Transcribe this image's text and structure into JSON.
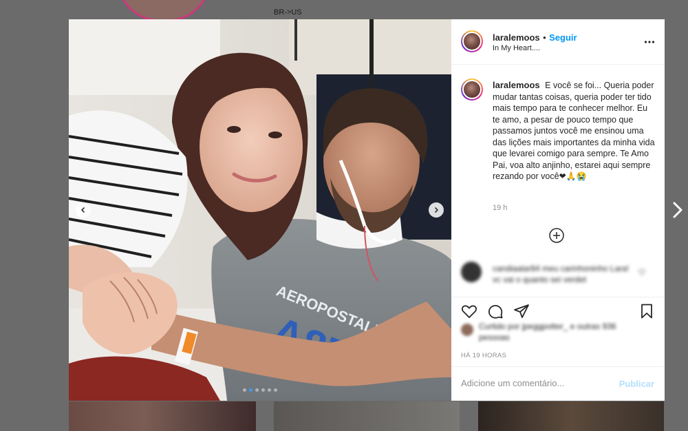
{
  "background": {
    "note_text": "BR->US"
  },
  "post": {
    "username": "laralemoos",
    "separator": "•",
    "follow_label": "Seguir",
    "location": "In My Heart....",
    "caption_text": "E você se foi... Queria poder mudar tantas coisas, queria poder ter tido mais tempo para te conhecer melhor. Eu te amo, a pesar de pouco tempo que passamos juntos você me ensinou uma das lições mais importantes da minha vida que levarei comigo para sempre. Te Amo Pai, voa alto anjinho, estarei aqui sempre rezando por você",
    "caption_emojis": "❤🙏😭",
    "caption_time": "19 h",
    "post_time": "HÁ 19 HORAS",
    "carousel": {
      "total": 6,
      "active_index": 1
    }
  },
  "comment_blurred": {
    "text": "candiaalar84 meu carinhoninho Lara! vc vai o quanto sei verdet"
  },
  "likes_blurred": {
    "text": "Curtido por jpeggpotter_ e outras 936 pessoas"
  },
  "add_comment": {
    "placeholder": "Adicione um comentário...",
    "publish_label": "Publicar"
  },
  "colors": {
    "accent_link": "#0095f6",
    "publish_disabled": "#b2dffc",
    "dot_active": "#3d9bf2"
  },
  "icons": {
    "more": "more-horizontal-icon",
    "load_more": "plus-circle-icon",
    "like": "heart-icon",
    "comment": "comment-icon",
    "share": "share-icon",
    "save": "bookmark-icon",
    "prev": "chevron-left-icon",
    "next": "chevron-right-icon"
  }
}
